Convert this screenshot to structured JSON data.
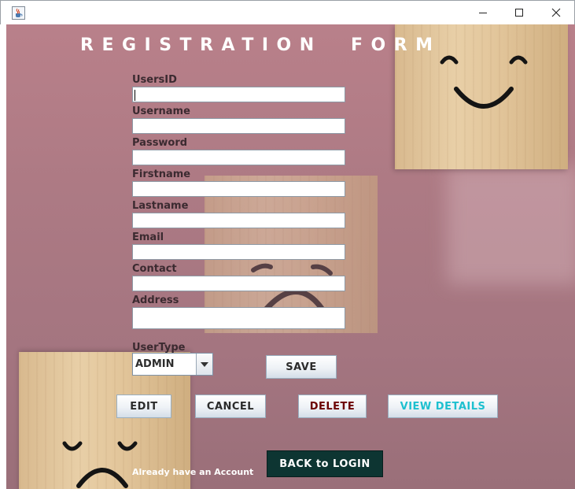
{
  "window": {
    "icon": "java-cup-icon",
    "controls": [
      "minimize-icon",
      "maximize-icon",
      "close-icon"
    ]
  },
  "form": {
    "title": "REGISTRATION  FORM",
    "fields": [
      {
        "label": "UsersID",
        "value": ""
      },
      {
        "label": "Username",
        "value": ""
      },
      {
        "label": "Password",
        "value": ""
      },
      {
        "label": "Firstname",
        "value": ""
      },
      {
        "label": "Lastname",
        "value": ""
      },
      {
        "label": "Email",
        "value": ""
      },
      {
        "label": "Contact",
        "value": ""
      },
      {
        "label": "Address",
        "value": ""
      }
    ],
    "usertype": {
      "label": "UserType",
      "value": "ADMIN"
    }
  },
  "buttons": {
    "save": "SAVE",
    "edit": "EDIT",
    "cancel": "CANCEL",
    "delete": "DELETE",
    "view_details": "VIEW DETAILS",
    "back_to_login": "BACK to LOGIN"
  },
  "footer": {
    "already_text": "Already have an Account"
  },
  "colors": {
    "background": "#b07b85",
    "back_button": "#0d3532",
    "delete_text": "#6b0000",
    "view_text": "#1ec0cf"
  }
}
